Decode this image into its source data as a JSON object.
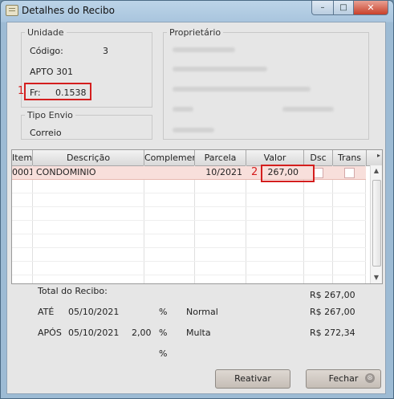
{
  "window": {
    "title": "Detalhes do Recibo",
    "min_glyph": "–",
    "max_glyph": "□",
    "close_glyph": "✕"
  },
  "unidade": {
    "legend": "Unidade",
    "codigo_label": "Código:",
    "codigo_value": "3",
    "apto": "APTO 301",
    "fr_label": "Fr:",
    "fr_value": "0.1538",
    "marker": "1"
  },
  "proprietario": {
    "legend": "Proprietário"
  },
  "tipo_envio": {
    "legend": "Tipo Envio",
    "value": "Correio"
  },
  "grid": {
    "headers": [
      "Item",
      "Descrição",
      "Complemento",
      "Parcela",
      "Valor",
      "Dsc",
      "Trans"
    ],
    "rows": [
      {
        "item": "0001",
        "descricao": "CONDOMINIO",
        "complemento": "",
        "parcela": "10/2021",
        "valor": "267,00",
        "dsc": false,
        "trans": false
      }
    ],
    "marker": "2",
    "scroll_right": "▸",
    "scroll_up": "▲",
    "scroll_down": "▼"
  },
  "totals": {
    "total_label": "Total do Recibo:",
    "total_value": "R$ 267,00",
    "ate_label": "ATÉ",
    "ate_date": "05/10/2021",
    "ate_pct_sign": "%",
    "ate_type": "Normal",
    "ate_value": "R$ 267,00",
    "apos_label": "APÓS",
    "apos_date": "05/10/2021",
    "apos_pct": "2,00",
    "apos_pct_sign": "%",
    "apos_type": "Multa",
    "apos_value": "R$ 272,34",
    "extra_pct_sign": "%"
  },
  "buttons": {
    "reativar": "Reativar",
    "fechar": "Fechar",
    "fechar_icon_glyph": "⊗"
  }
}
